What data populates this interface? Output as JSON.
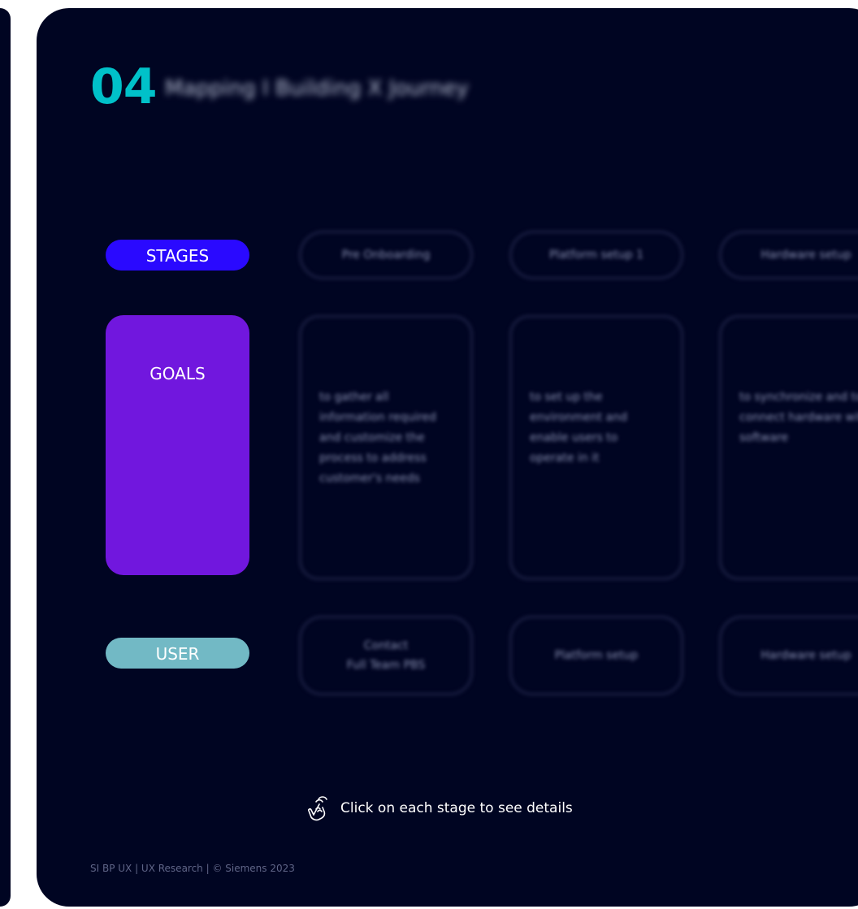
{
  "header": {
    "number": "04",
    "title": "Mapping I Building X Journey"
  },
  "rows": {
    "stages_label": "STAGES",
    "goals_label": "GOALS",
    "user_label": "USER"
  },
  "stages": [
    "Pre Onboarding",
    "Platform setup 1",
    "Hardware setup"
  ],
  "goals": [
    "to gather all information required and customize the process to address customer's needs",
    "to set up the environment and enable users to operate in it",
    "to synchronize and to connect hardware with software"
  ],
  "user_items": [
    "Contact\nFull Team PBS",
    "Platform setup",
    "Hardware setup"
  ],
  "hint": {
    "icon": "hand-tap-icon",
    "text": "Click on each stage to see details"
  },
  "footer": {
    "text": "SI BP UX | UX Research | © Siemens 2023"
  },
  "colors": {
    "background": "#000522",
    "accent_number": "#00c1c9",
    "stages": "#2a09ff",
    "goals": "#7117de",
    "user": "#72b9c5"
  }
}
